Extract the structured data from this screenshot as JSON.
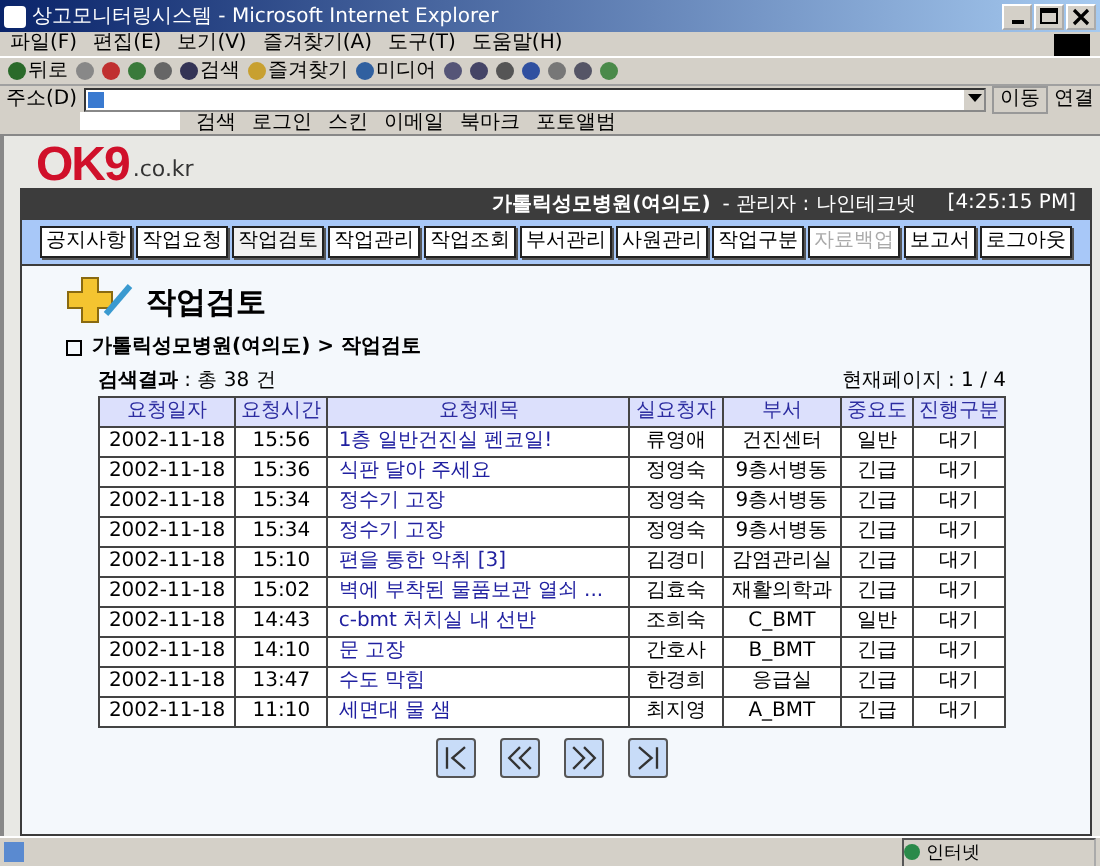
{
  "window": {
    "title": "상고모니터링시스템 - Microsoft Internet Explorer"
  },
  "menu": [
    "파일(F)",
    "편집(E)",
    "보기(V)",
    "즐겨찾기(A)",
    "도구(T)",
    "도움말(H)"
  ],
  "toolbar": [
    {
      "kind": "back",
      "label": "뒤로"
    },
    {
      "kind": "forward"
    },
    {
      "kind": "stop"
    },
    {
      "kind": "refresh"
    },
    {
      "kind": "home"
    },
    {
      "kind": "search",
      "label": "검색"
    },
    {
      "kind": "favorites",
      "label": "즐겨찾기"
    },
    {
      "kind": "media",
      "label": "미디어"
    },
    {
      "kind": "history"
    },
    {
      "kind": "mail"
    },
    {
      "kind": "print"
    },
    {
      "kind": "edit"
    },
    {
      "kind": "discuss"
    },
    {
      "kind": "tool"
    },
    {
      "kind": "messenger"
    }
  ],
  "address": {
    "label": "주소(D)",
    "go": "이동",
    "links": "연결"
  },
  "links_bar": [
    "검색",
    "로그인",
    "스킨",
    "이메일",
    "북마크",
    "포토앨범"
  ],
  "logo": {
    "mark": "OK9",
    "domain": ".co.kr"
  },
  "header": {
    "hospital": "가톨릭성모병원(여의도)",
    "admin": "- 관리자 : 나인테크넷",
    "time": "[4:25:15 PM]"
  },
  "nav": [
    {
      "label": "공지사항",
      "selected": false,
      "disabled": false
    },
    {
      "label": "작업요청",
      "selected": false,
      "disabled": false
    },
    {
      "label": "작업검토",
      "selected": true,
      "disabled": false
    },
    {
      "label": "작업관리",
      "selected": false,
      "disabled": false
    },
    {
      "label": "작업조회",
      "selected": false,
      "disabled": false
    },
    {
      "label": "부서관리",
      "selected": false,
      "disabled": false
    },
    {
      "label": "사원관리",
      "selected": false,
      "disabled": false
    },
    {
      "label": "작업구분",
      "selected": false,
      "disabled": false
    },
    {
      "label": "자료백업",
      "selected": false,
      "disabled": true
    },
    {
      "label": "보고서",
      "selected": false,
      "disabled": false
    },
    {
      "label": "로그아웃",
      "selected": false,
      "disabled": false
    }
  ],
  "page_title": "작업검토",
  "breadcrumb": "가톨릭성모병원(여의도) > 작업검토",
  "result": {
    "label": "검색결과",
    "count": ": 총 38 건",
    "page": "현재페이지 : 1 / 4"
  },
  "table": {
    "columns": [
      "요청일자",
      "요청시간",
      "요청제목",
      "실요청자",
      "부서",
      "중요도",
      "진행구분"
    ],
    "rows": [
      [
        "2002-11-18",
        "15:56",
        "1층 일반건진실 펜코일!",
        "류영애",
        "건진센터",
        "일반",
        "대기"
      ],
      [
        "2002-11-18",
        "15:36",
        "식판 달아 주세요",
        "정영숙",
        "9층서병동",
        "긴급",
        "대기"
      ],
      [
        "2002-11-18",
        "15:34",
        "정수기 고장",
        "정영숙",
        "9층서병동",
        "긴급",
        "대기"
      ],
      [
        "2002-11-18",
        "15:34",
        "정수기 고장",
        "정영숙",
        "9층서병동",
        "긴급",
        "대기"
      ],
      [
        "2002-11-18",
        "15:10",
        "편을 통한 악취 [3]",
        "김경미",
        "감염관리실",
        "긴급",
        "대기"
      ],
      [
        "2002-11-18",
        "15:02",
        "벽에 부착된 물품보관 열쇠 ...",
        "김효숙",
        "재활의학과",
        "긴급",
        "대기"
      ],
      [
        "2002-11-18",
        "14:43",
        "c-bmt 처치실 내 선반",
        "조희숙",
        "C_BMT",
        "일반",
        "대기"
      ],
      [
        "2002-11-18",
        "14:10",
        "문 고장",
        "간호사",
        "B_BMT",
        "긴급",
        "대기"
      ],
      [
        "2002-11-18",
        "13:47",
        "수도 막힘",
        "한경희",
        "응급실",
        "긴급",
        "대기"
      ],
      [
        "2002-11-18",
        "11:10",
        "세면대 물 샘",
        "최지영",
        "A_BMT",
        "긴급",
        "대기"
      ]
    ]
  },
  "pager": [
    {
      "kind": "first"
    },
    {
      "kind": "prev"
    },
    {
      "kind": "next"
    },
    {
      "kind": "last"
    }
  ],
  "status_bar": {
    "zone": "인터넷"
  }
}
